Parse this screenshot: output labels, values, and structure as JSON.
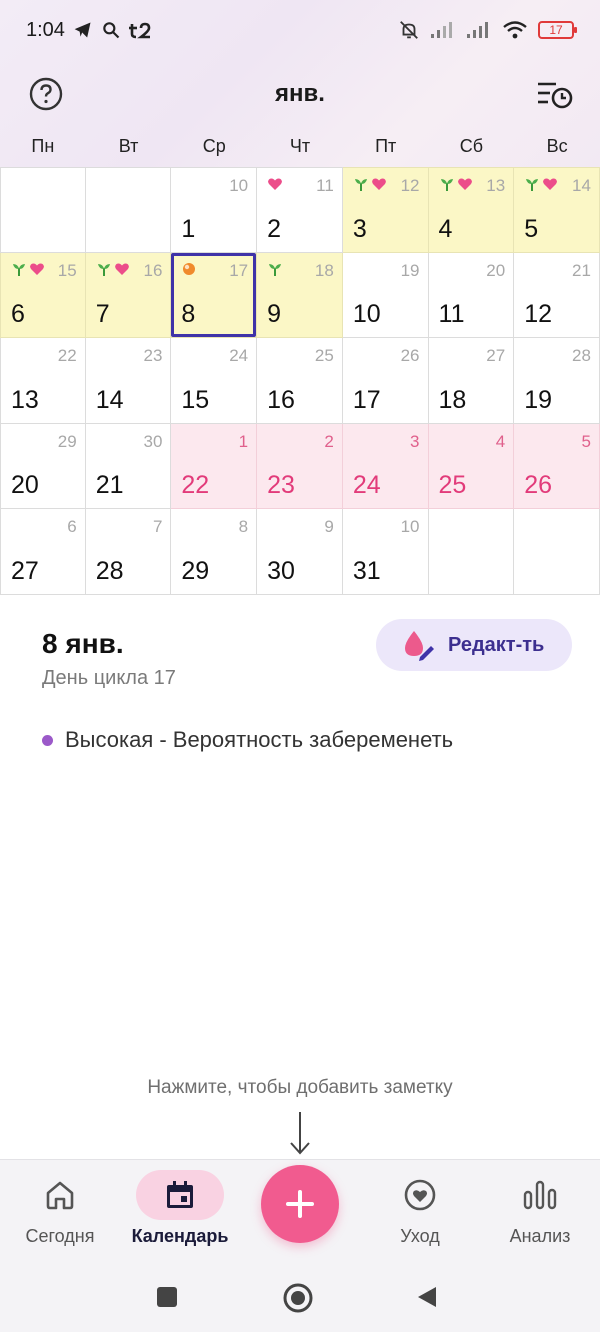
{
  "status_bar": {
    "time": "1:04",
    "battery": "17"
  },
  "header": {
    "month_title": "янв.",
    "help_icon": "help-circle-icon",
    "cycle_icon": "cycle-history-icon"
  },
  "weekdays": [
    "Пн",
    "Вт",
    "Ср",
    "Чт",
    "Пт",
    "Сб",
    "Вс"
  ],
  "colors": {
    "fertile_bg": "#fbf7c6",
    "period_bg": "#fce8ee",
    "period_text": "#e23b7a",
    "selected_border": "#3f33a8",
    "accent_pink": "#f15b8f",
    "edit_btn_bg": "#ece7fa",
    "probability_dot": "#9b59c9"
  },
  "calendar": {
    "cells": [
      {
        "day": "",
        "cycle": "",
        "type": "empty",
        "marks": []
      },
      {
        "day": "",
        "cycle": "",
        "type": "empty",
        "marks": []
      },
      {
        "day": "1",
        "cycle": "10",
        "type": "normal",
        "marks": []
      },
      {
        "day": "2",
        "cycle": "11",
        "type": "normal",
        "marks": [
          "heart"
        ]
      },
      {
        "day": "3",
        "cycle": "12",
        "type": "fertile",
        "marks": [
          "sprout",
          "heart"
        ]
      },
      {
        "day": "4",
        "cycle": "13",
        "type": "fertile",
        "marks": [
          "sprout",
          "heart"
        ]
      },
      {
        "day": "5",
        "cycle": "14",
        "type": "fertile",
        "marks": [
          "sprout",
          "heart"
        ]
      },
      {
        "day": "6",
        "cycle": "15",
        "type": "fertile",
        "marks": [
          "sprout",
          "heart"
        ]
      },
      {
        "day": "7",
        "cycle": "16",
        "type": "fertile",
        "marks": [
          "sprout",
          "heart"
        ]
      },
      {
        "day": "8",
        "cycle": "17",
        "type": "fertile",
        "marks": [
          "ovulation"
        ],
        "selected": true
      },
      {
        "day": "9",
        "cycle": "18",
        "type": "fertile",
        "marks": [
          "sprout"
        ]
      },
      {
        "day": "10",
        "cycle": "19",
        "type": "normal",
        "marks": []
      },
      {
        "day": "11",
        "cycle": "20",
        "type": "normal",
        "marks": []
      },
      {
        "day": "12",
        "cycle": "21",
        "type": "normal",
        "marks": []
      },
      {
        "day": "13",
        "cycle": "22",
        "type": "normal",
        "marks": []
      },
      {
        "day": "14",
        "cycle": "23",
        "type": "normal",
        "marks": []
      },
      {
        "day": "15",
        "cycle": "24",
        "type": "normal",
        "marks": []
      },
      {
        "day": "16",
        "cycle": "25",
        "type": "normal",
        "marks": []
      },
      {
        "day": "17",
        "cycle": "26",
        "type": "normal",
        "marks": []
      },
      {
        "day": "18",
        "cycle": "27",
        "type": "normal",
        "marks": []
      },
      {
        "day": "19",
        "cycle": "28",
        "type": "normal",
        "marks": []
      },
      {
        "day": "20",
        "cycle": "29",
        "type": "normal",
        "marks": []
      },
      {
        "day": "21",
        "cycle": "30",
        "type": "normal",
        "marks": []
      },
      {
        "day": "22",
        "cycle": "1",
        "type": "period",
        "marks": []
      },
      {
        "day": "23",
        "cycle": "2",
        "type": "period",
        "marks": []
      },
      {
        "day": "24",
        "cycle": "3",
        "type": "period",
        "marks": []
      },
      {
        "day": "25",
        "cycle": "4",
        "type": "period",
        "marks": []
      },
      {
        "day": "26",
        "cycle": "5",
        "type": "period",
        "marks": []
      },
      {
        "day": "27",
        "cycle": "6",
        "type": "normal",
        "marks": []
      },
      {
        "day": "28",
        "cycle": "7",
        "type": "normal",
        "marks": []
      },
      {
        "day": "29",
        "cycle": "8",
        "type": "normal",
        "marks": []
      },
      {
        "day": "30",
        "cycle": "9",
        "type": "normal",
        "marks": []
      },
      {
        "day": "31",
        "cycle": "10",
        "type": "normal",
        "marks": []
      },
      {
        "day": "",
        "cycle": "",
        "type": "empty",
        "marks": []
      },
      {
        "day": "",
        "cycle": "",
        "type": "empty",
        "marks": []
      }
    ]
  },
  "details": {
    "date": "8 янв.",
    "cycle_day": "День цикла 17",
    "edit_label": "Редакт-ть",
    "probability": "Высокая - Вероятность забеременеть"
  },
  "hint": "Нажмите, чтобы добавить заметку",
  "bottom_nav": {
    "today": "Сегодня",
    "calendar": "Календарь",
    "care": "Уход",
    "analysis": "Анализ"
  }
}
